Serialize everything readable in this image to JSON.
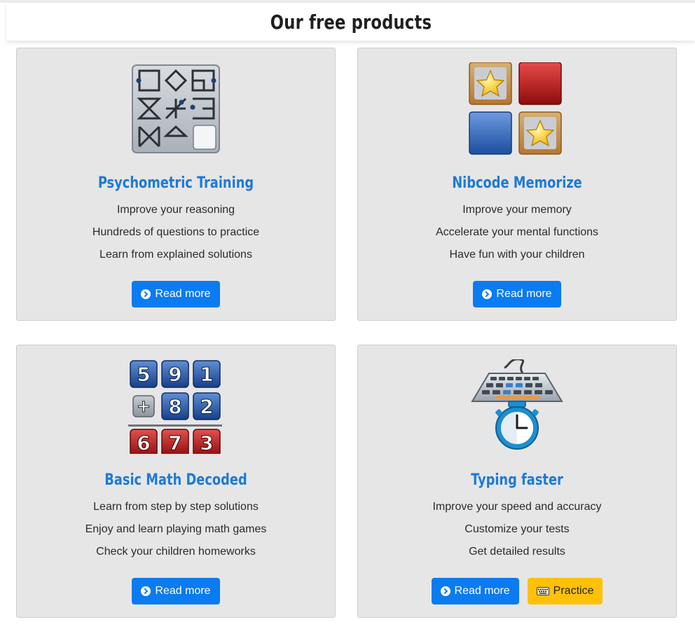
{
  "page_title": "Our free products",
  "products": [
    {
      "title": "Psychometric Training",
      "lines": [
        "Improve your reasoning",
        "Hundreds of questions to practice",
        "Learn from explained solutions"
      ],
      "read_more": "Read more"
    },
    {
      "title": "Nibcode Memorize",
      "lines": [
        "Improve your memory",
        "Accelerate your mental functions",
        "Have fun with your children"
      ],
      "read_more": "Read more"
    },
    {
      "title": "Basic Math Decoded",
      "lines": [
        "Learn from step by step solutions",
        "Enjoy and learn playing math games",
        "Check your children homeworks"
      ],
      "read_more": "Read more",
      "digits_top": [
        "5",
        "9",
        "1"
      ],
      "digits_mid": [
        "+",
        "8",
        "2"
      ],
      "digits_result": [
        "6",
        "7",
        "3"
      ]
    },
    {
      "title": "Typing faster",
      "lines": [
        "Improve your speed and accuracy",
        "Customize your tests",
        "Get detailed results"
      ],
      "read_more": "Read more",
      "practice": "Practice"
    }
  ],
  "colors": {
    "accent_title": "#1e7ad6",
    "primary_button": "#0a7bf0",
    "warning_button": "#ffc107",
    "card_bg": "#e6e6e6"
  },
  "icons": {
    "read_more": "chevron-circle-right-icon",
    "practice": "keyboard-icon"
  }
}
